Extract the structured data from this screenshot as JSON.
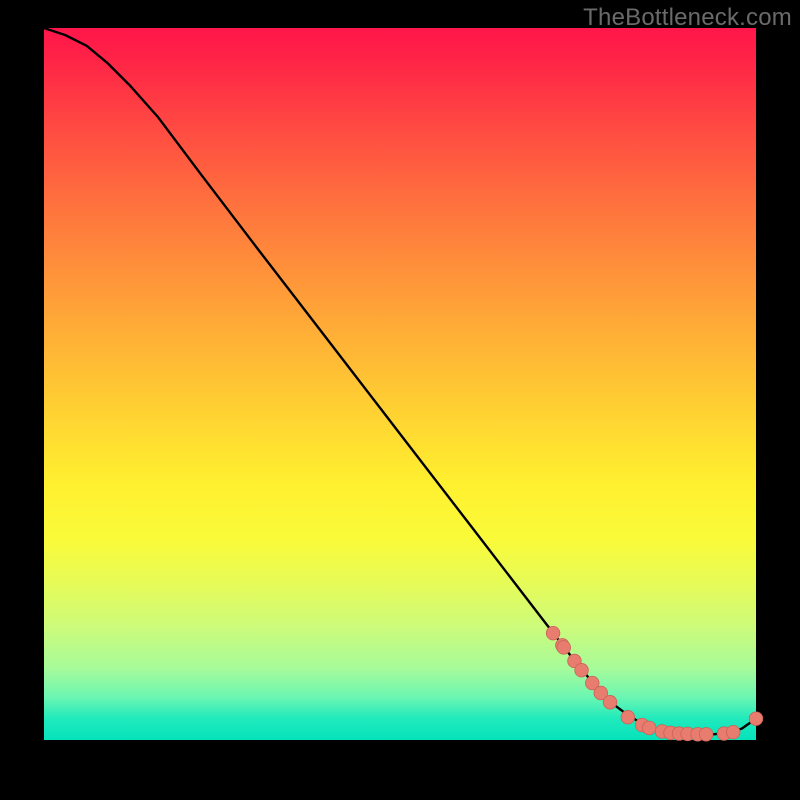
{
  "watermark": "TheBottleneck.com",
  "colors": {
    "background": "#000000",
    "curve": "#000000",
    "marker_fill": "#e77c6f",
    "marker_stroke": "#c96457"
  },
  "chart_data": {
    "type": "line",
    "title": "",
    "xlabel": "",
    "ylabel": "",
    "xlim": [
      0,
      100
    ],
    "ylim": [
      0,
      100
    ],
    "grid": false,
    "legend": false,
    "x": [
      0,
      3,
      6,
      9,
      12,
      16,
      22,
      30,
      40,
      50,
      60,
      70,
      75,
      78,
      80,
      82,
      84,
      86,
      88,
      90,
      92,
      94,
      96,
      98,
      100
    ],
    "values": [
      100,
      99,
      97.5,
      95,
      92,
      87.5,
      79.5,
      69,
      56,
      43,
      30,
      17,
      10.5,
      7,
      5,
      3.5,
      2.3,
      1.5,
      1.1,
      0.9,
      0.8,
      0.8,
      1.0,
      1.6,
      3.0
    ],
    "markers": [
      {
        "x": 71.5,
        "y": 15.0
      },
      {
        "x": 72.8,
        "y": 13.3
      },
      {
        "x": 73.0,
        "y": 13.0
      },
      {
        "x": 74.5,
        "y": 11.1
      },
      {
        "x": 75.5,
        "y": 9.8
      },
      {
        "x": 77.0,
        "y": 8.0
      },
      {
        "x": 78.2,
        "y": 6.6
      },
      {
        "x": 79.5,
        "y": 5.3
      },
      {
        "x": 82.0,
        "y": 3.2
      },
      {
        "x": 84.0,
        "y": 2.1
      },
      {
        "x": 85.0,
        "y": 1.7
      },
      {
        "x": 86.8,
        "y": 1.2
      },
      {
        "x": 88.0,
        "y": 1.0
      },
      {
        "x": 89.2,
        "y": 0.9
      },
      {
        "x": 90.4,
        "y": 0.85
      },
      {
        "x": 91.8,
        "y": 0.8
      },
      {
        "x": 93.0,
        "y": 0.8
      },
      {
        "x": 95.5,
        "y": 0.9
      },
      {
        "x": 96.8,
        "y": 1.1
      },
      {
        "x": 100.0,
        "y": 3.0
      }
    ]
  }
}
